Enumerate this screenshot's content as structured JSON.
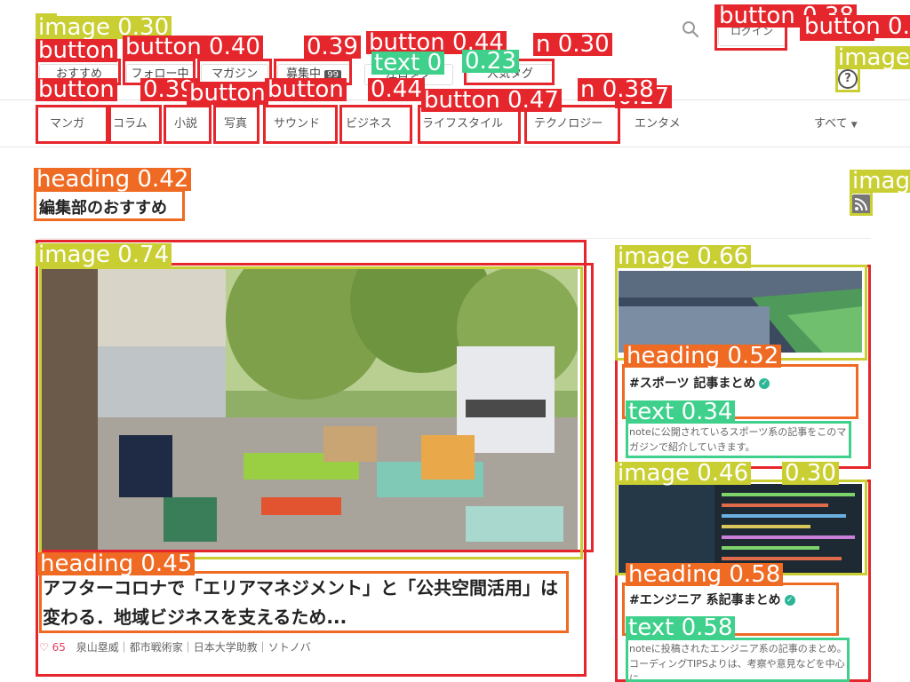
{
  "header": {
    "login_label": "ログイン",
    "help_symbol": "?",
    "nav_pills": [
      {
        "label": "おすすめ"
      },
      {
        "label": "フォロー中"
      },
      {
        "label": "マガジン"
      },
      {
        "label": "募集中",
        "badge": "99"
      },
      {
        "label": "注目タグ"
      },
      {
        "label": "人気タグ"
      }
    ],
    "categories": [
      "マンガ",
      "コラム",
      "小説",
      "写真",
      "サウンド",
      "ビジネス",
      "ライフスタイル",
      "テクノロジー",
      "エンタメ"
    ],
    "all_label": "すべて"
  },
  "section": {
    "title": "編集部のおすすめ"
  },
  "main_article": {
    "title": "アフターコロナで「エリアマネジメント」と「公共空間活用」は変わる．地域ビジネスを支えるため...",
    "likes": "65",
    "author": "泉山塁威｜都市戦術家｜日本大学助教｜ソトノバ"
  },
  "side_articles": [
    {
      "title": "#スポーツ 記事まとめ",
      "desc": "noteに公開されているスポーツ系の記事をこのマガジンで紹介していきます。"
    },
    {
      "title": "#エンジニア 系記事まとめ",
      "desc": "noteに投稿されたエンジニア系の記事のまとめ。コーディングTIPSよりは、考察や意見などを中心に。"
    }
  ],
  "overlay": {
    "labels": [
      "image 0.30",
      "button",
      "button 0.40",
      "0.39",
      "button 0.44",
      "n 0.30",
      "button 0.38",
      "button 0.3",
      "image",
      "text 0",
      "0.23",
      "button",
      "0.39",
      "button",
      "button",
      "0.44",
      "button 0.47",
      "0.27",
      "n 0.38",
      "heading 0.42",
      "image",
      "image 0.74",
      "image 0.66",
      "heading 0.52",
      "text 0.34",
      "image 0.46",
      "0.30",
      "heading 0.58",
      "text 0.58",
      "heading 0.45"
    ]
  },
  "colors": {
    "accent": "#2cb696",
    "like": "#e0415e",
    "det_red": "#e5262c",
    "det_orange": "#ef6a22",
    "det_green": "#3fd08c",
    "det_olive": "#c9cf33"
  },
  "icons": [
    "search-icon",
    "help-icon",
    "rss-icon",
    "heart-icon",
    "verified-icon",
    "chevron-down-icon"
  ]
}
